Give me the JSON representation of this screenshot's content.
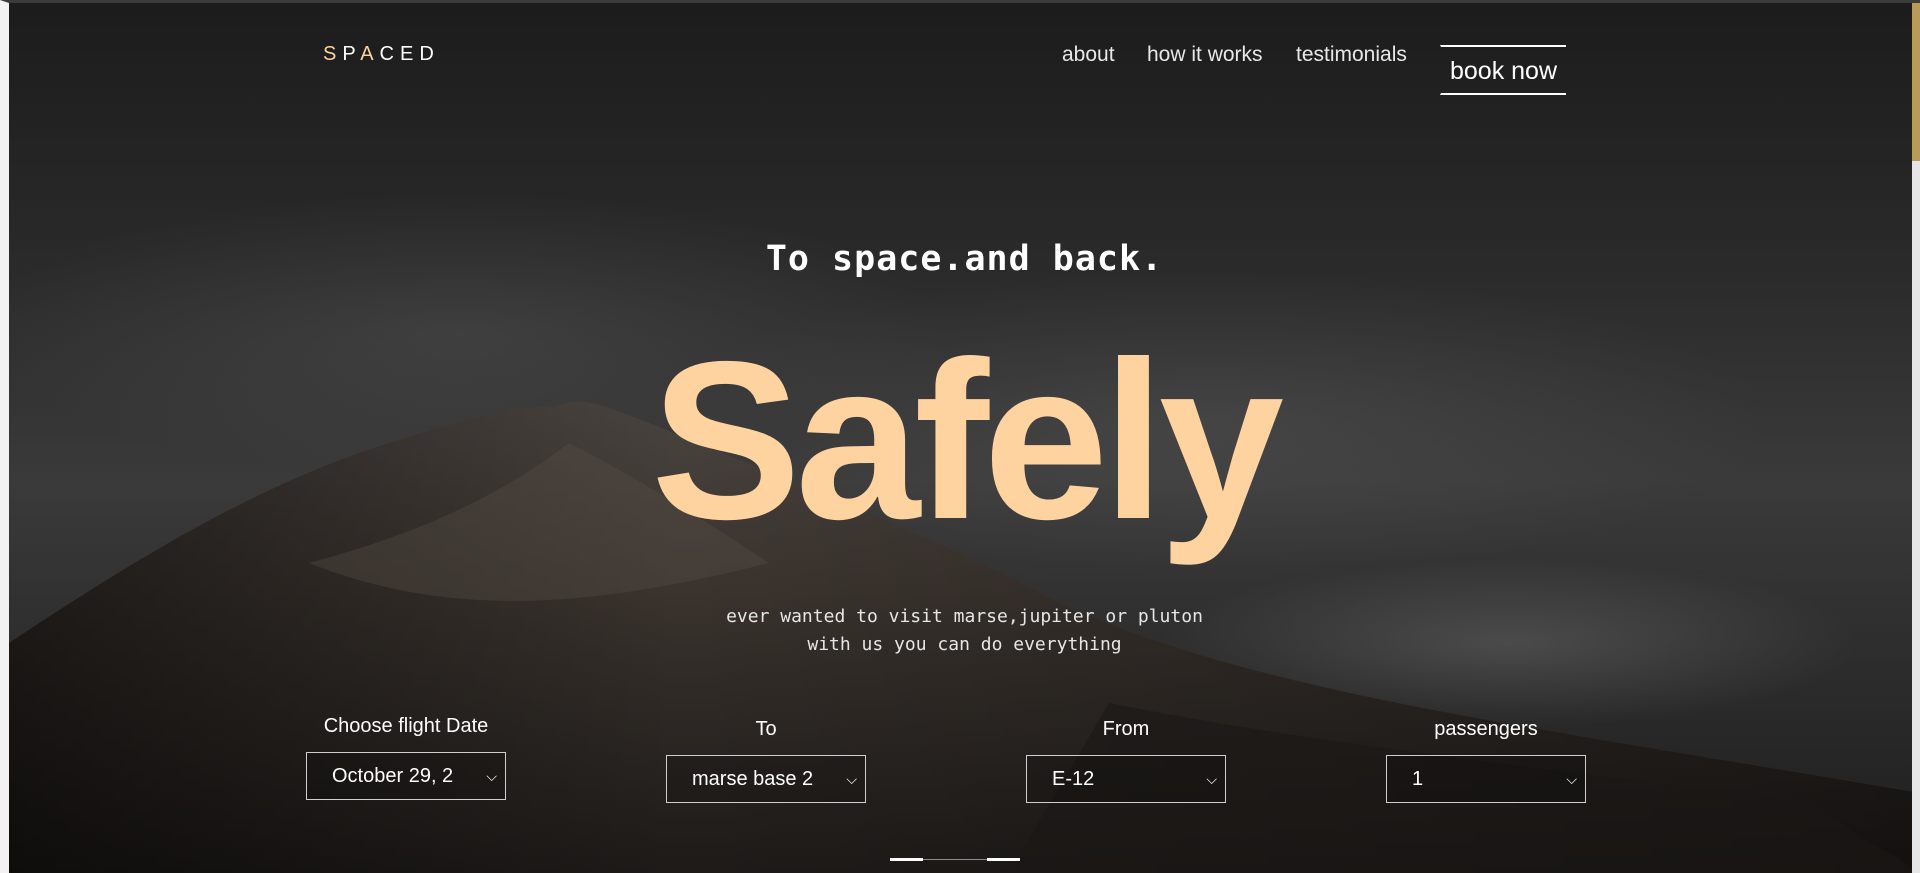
{
  "brand": {
    "letters": [
      "S",
      "P",
      "A",
      "C",
      "E",
      "D"
    ]
  },
  "nav": {
    "links": [
      "about",
      "how it works",
      "testimonials"
    ],
    "book_label": "book now"
  },
  "hero": {
    "tagline": "To space.and back.",
    "headline": "Safely",
    "description_line1": "ever wanted to visit marse,jupiter or pluton",
    "description_line2": "with us you can do everything"
  },
  "booking": {
    "date": {
      "label": "Choose flight Date",
      "value": "October 29, 2"
    },
    "to": {
      "label": "To",
      "value": "marse base 2"
    },
    "from": {
      "label": "From",
      "value": "E-12"
    },
    "passengers": {
      "label": "passengers",
      "value": "1"
    }
  },
  "colors": {
    "accent_peach": "#ffd3a0",
    "text_white": "#ffffff",
    "scroll_thumb": "#b89a5a"
  },
  "icons": {
    "select_chevron": "chevron-down-icon"
  }
}
